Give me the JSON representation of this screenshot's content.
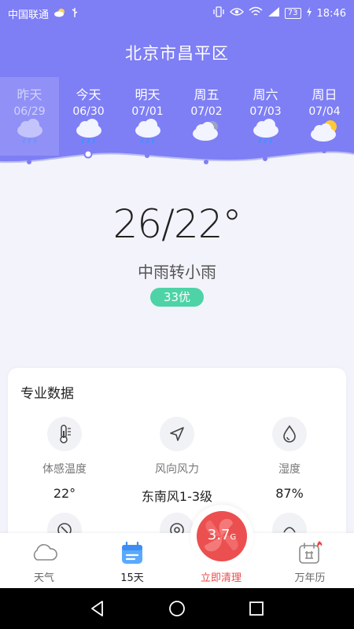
{
  "status_bar": {
    "carrier": "中国联通",
    "battery": "73",
    "time": "18:46",
    "icons": [
      "weather-icon",
      "usb-icon",
      "vibrate-icon",
      "eye-icon",
      "wifi-icon",
      "signal-icon",
      "charging-icon"
    ]
  },
  "header": {
    "city": "北京市昌平区",
    "background": "#7e7ef5"
  },
  "forecast": [
    {
      "day": "昨天",
      "date": "06/29",
      "icon": "rain-cloud-icon"
    },
    {
      "day": "今天",
      "date": "06/30",
      "icon": "rain-cloud-icon"
    },
    {
      "day": "明天",
      "date": "07/01",
      "icon": "rain-cloud-icon"
    },
    {
      "day": "周五",
      "date": "07/02",
      "icon": "cloudy-icon"
    },
    {
      "day": "周六",
      "date": "07/03",
      "icon": "rain-cloud-icon"
    },
    {
      "day": "周日",
      "date": "07/04",
      "icon": "partly-sunny-icon"
    }
  ],
  "current": {
    "temperature": "26/22°",
    "condition": "中雨转小雨",
    "aqi": "33优",
    "aqi_color": "#4dd3a6"
  },
  "pro_data": {
    "title": "专业数据",
    "metrics": [
      {
        "label": "体感温度",
        "value": "22°",
        "icon": "thermometer-icon"
      },
      {
        "label": "风向风力",
        "value": "东南风1-3级",
        "icon": "wind-direction-icon"
      },
      {
        "label": "湿度",
        "value": "87%",
        "icon": "humidity-drop-icon"
      }
    ]
  },
  "bottom_nav": {
    "items": [
      {
        "label": "天气",
        "icon": "cloud-icon"
      },
      {
        "label": "15天",
        "icon": "calendar-list-icon"
      },
      {
        "label": "立即清理",
        "icon": "clean-fan-icon"
      },
      {
        "label": "万年历",
        "icon": "almanac-calendar-icon"
      }
    ],
    "clean_size": "3.7",
    "clean_unit": "G",
    "clean_color": "#ec4f4f"
  },
  "system_nav": [
    "back-icon",
    "home-icon",
    "recents-icon"
  ]
}
